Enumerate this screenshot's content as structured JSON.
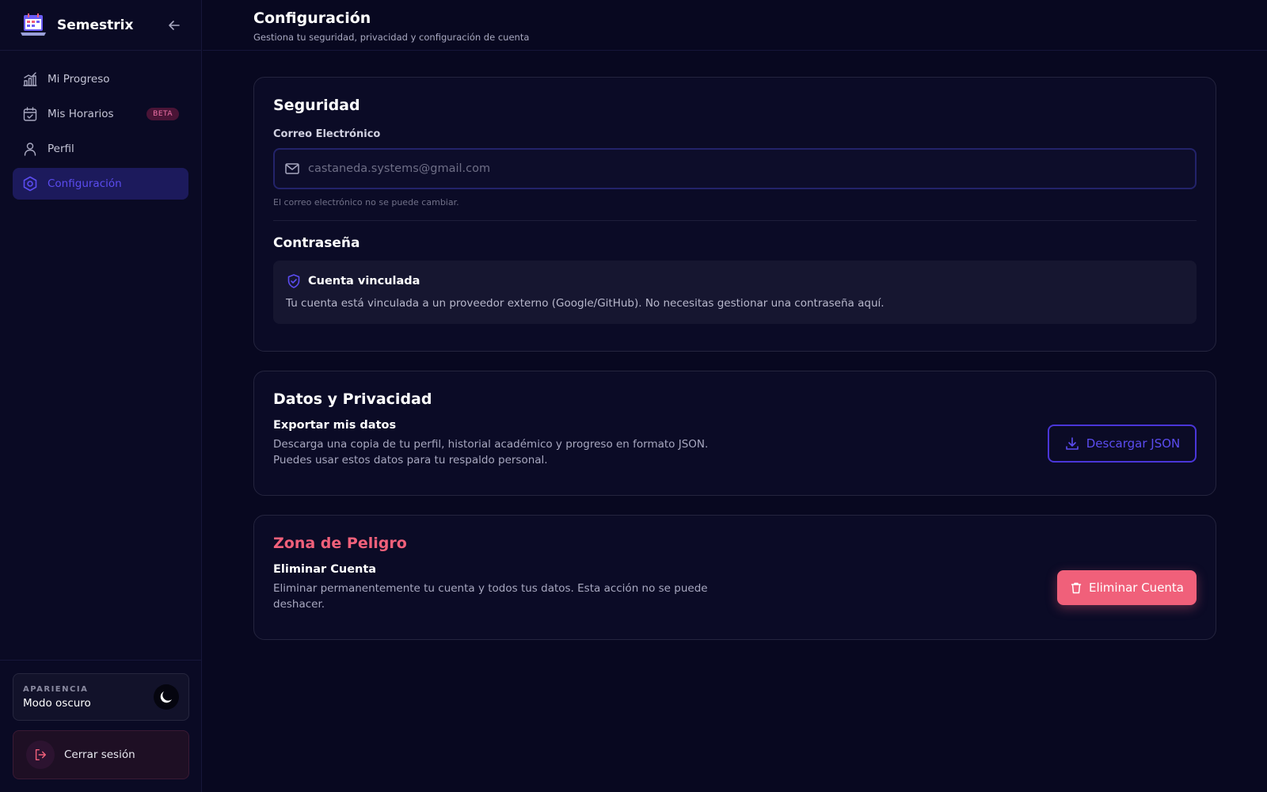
{
  "brand": {
    "name": "Semestrix"
  },
  "sidebar": {
    "items": [
      {
        "label": "Mi Progreso",
        "icon": "chart-icon"
      },
      {
        "label": "Mis Horarios",
        "icon": "calendar-check-icon",
        "badge": "BETA"
      },
      {
        "label": "Perfil",
        "icon": "user-icon"
      },
      {
        "label": "Configuración",
        "icon": "settings-icon",
        "active": true
      }
    ],
    "appearance": {
      "caption": "APARIENCIA",
      "mode": "Modo oscuro"
    },
    "logout": "Cerrar sesión"
  },
  "header": {
    "title": "Configuración",
    "subtitle": "Gestiona tu seguridad, privacidad y configuración de cuenta"
  },
  "security": {
    "title": "Seguridad",
    "email_label": "Correo Electrónico",
    "email_value": "castaneda.systems@gmail.com",
    "email_hint": "El correo electrónico no se puede cambiar.",
    "password_title": "Contraseña",
    "linked_title": "Cuenta vinculada",
    "linked_desc": "Tu cuenta está vinculada a un proveedor externo (Google/GitHub). No necesitas gestionar una contraseña aquí."
  },
  "privacy": {
    "title": "Datos y Privacidad",
    "export_title": "Exportar mis datos",
    "export_desc": "Descarga una copia de tu perfil, historial académico y progreso en formato JSON. Puedes usar estos datos para tu respaldo personal.",
    "download_label": "Descargar JSON"
  },
  "danger": {
    "title": "Zona de Peligro",
    "delete_title": "Eliminar Cuenta",
    "delete_desc": "Eliminar permanentemente tu cuenta y todos tus datos. Esta acción no se puede deshacer.",
    "delete_label": "Eliminar Cuenta"
  },
  "colors": {
    "accent": "#5b4cf0",
    "danger": "#f0607a",
    "background": "#080820"
  }
}
